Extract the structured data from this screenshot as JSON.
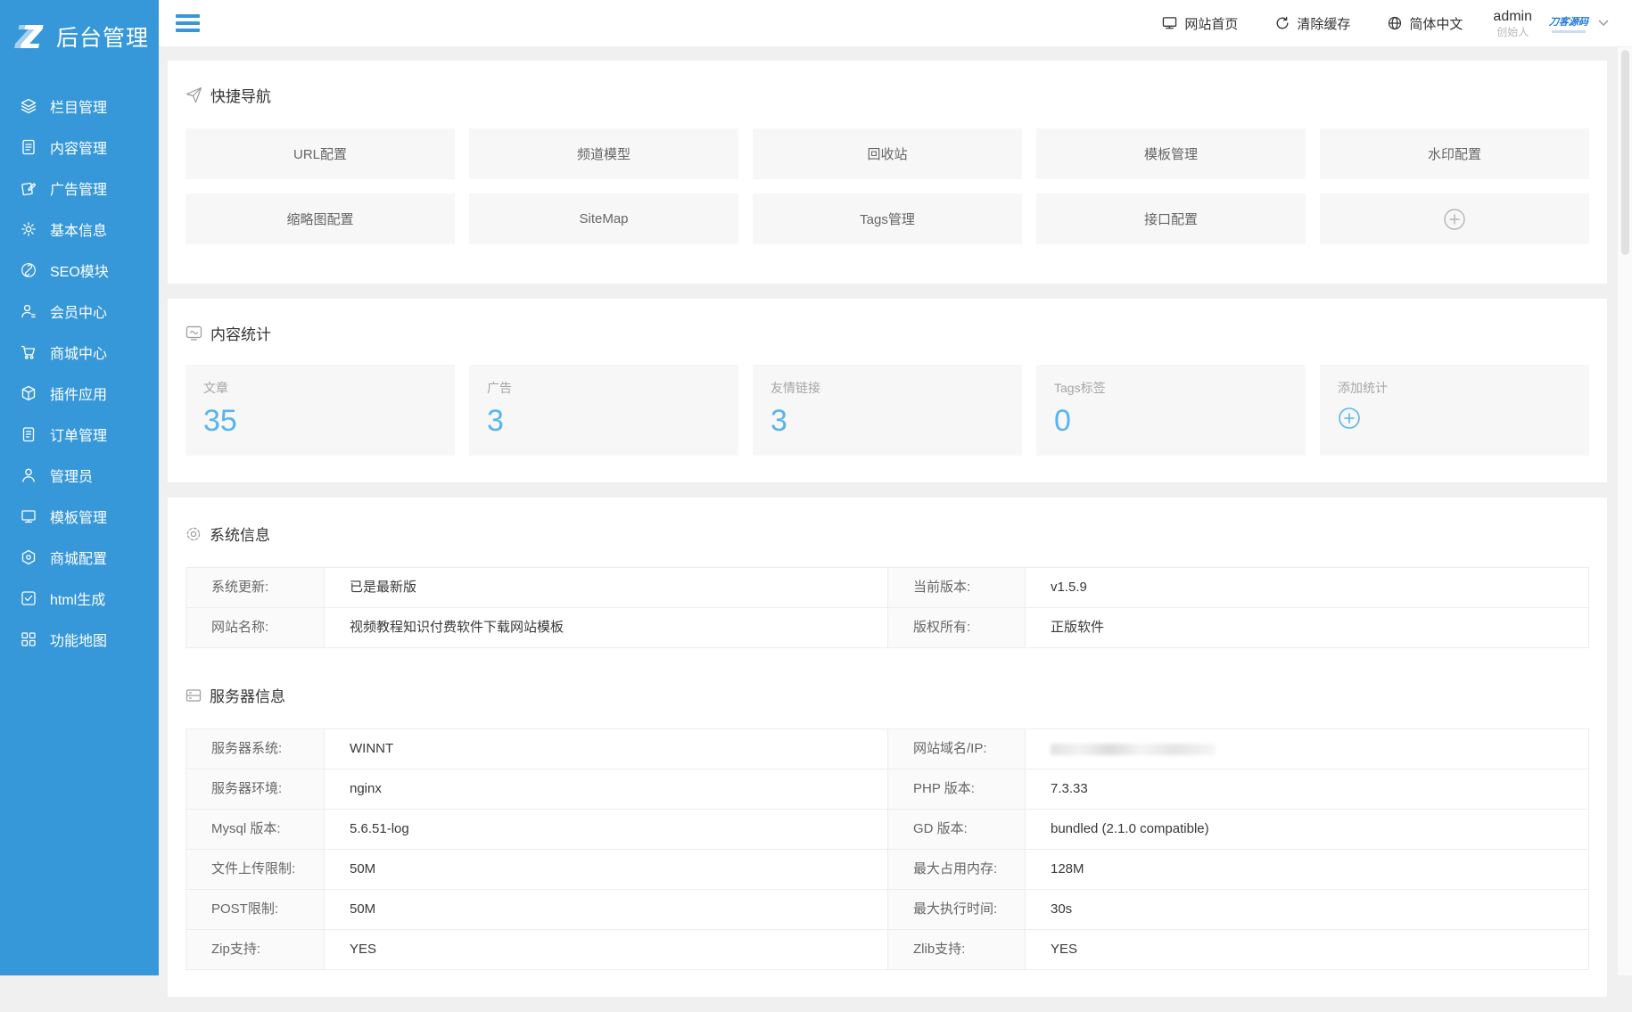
{
  "colors": {
    "sidebar": "#3798d9",
    "accent_number": "#57b5ec",
    "brand_blue": "#1f78d4",
    "card_bg": "#ffffff",
    "page_bg": "#f0f0f0",
    "tile_bg": "#f7f7f7"
  },
  "sidebar": {
    "logo_title": "后台管理",
    "items": [
      {
        "icon": "layers-icon",
        "label": "栏目管理"
      },
      {
        "icon": "document-icon",
        "label": "内容管理"
      },
      {
        "icon": "ad-pages-icon",
        "label": "广告管理"
      },
      {
        "icon": "gear-icon",
        "label": "基本信息"
      },
      {
        "icon": "link-circle-icon",
        "label": "SEO模块"
      },
      {
        "icon": "member-icon",
        "label": "会员中心"
      },
      {
        "icon": "cart-icon",
        "label": "商城中心"
      },
      {
        "icon": "cube-icon",
        "label": "插件应用"
      },
      {
        "icon": "clipboard-icon",
        "label": "订单管理"
      },
      {
        "icon": "person-icon",
        "label": "管理员"
      },
      {
        "icon": "monitor-icon",
        "label": "模板管理"
      },
      {
        "icon": "hexagon-gear-icon",
        "label": "商城配置"
      },
      {
        "icon": "check-square-icon",
        "label": "html生成"
      },
      {
        "icon": "grid-icon",
        "label": "功能地图"
      }
    ]
  },
  "topbar": {
    "links": [
      {
        "icon": "monitor-icon",
        "label": "网站首页"
      },
      {
        "icon": "refresh-icon",
        "label": "清除缓存"
      },
      {
        "icon": "globe-icon",
        "label": "简体中文"
      }
    ],
    "user": {
      "name": "admin",
      "role": "创始人"
    },
    "brand": {
      "text": "刀客源码"
    }
  },
  "quick_nav": {
    "title": "快捷导航",
    "buttons": [
      "URL配置",
      "频道模型",
      "回收站",
      "模板管理",
      "水印配置",
      "缩略图配置",
      "SiteMap",
      "Tags管理",
      "接口配置"
    ]
  },
  "content_stats": {
    "title": "内容统计",
    "stats": [
      {
        "label": "文章",
        "value": "35"
      },
      {
        "label": "广告",
        "value": "3"
      },
      {
        "label": "友情链接",
        "value": "3"
      },
      {
        "label": "Tags标签",
        "value": "0"
      },
      {
        "label": "添加统计",
        "value": ""
      }
    ]
  },
  "system_info": {
    "title": "系统信息",
    "rows": [
      [
        {
          "label": "系统更新:",
          "value": "已是最新版"
        },
        {
          "label": "当前版本:",
          "value": "v1.5.9"
        }
      ],
      [
        {
          "label": "网站名称:",
          "value": "视频教程知识付费软件下载网站模板"
        },
        {
          "label": "版权所有:",
          "value": "正版软件"
        }
      ]
    ]
  },
  "server_info": {
    "title": "服务器信息",
    "rows": [
      [
        {
          "label": "服务器系统:",
          "value": "WINNT"
        },
        {
          "label": "网站域名/IP:",
          "value": "",
          "redacted": true
        }
      ],
      [
        {
          "label": "服务器环境:",
          "value": "nginx"
        },
        {
          "label": "PHP 版本:",
          "value": "7.3.33"
        }
      ],
      [
        {
          "label": "Mysql 版本:",
          "value": "5.6.51-log"
        },
        {
          "label": "GD 版本:",
          "value": "bundled (2.1.0 compatible)"
        }
      ],
      [
        {
          "label": "文件上传限制:",
          "value": "50M"
        },
        {
          "label": "最大占用内存:",
          "value": "128M"
        }
      ],
      [
        {
          "label": "POST限制:",
          "value": "50M"
        },
        {
          "label": "最大执行时间:",
          "value": "30s"
        }
      ],
      [
        {
          "label": "Zip支持:",
          "value": "YES"
        },
        {
          "label": "Zlib支持:",
          "value": "YES"
        }
      ]
    ]
  }
}
